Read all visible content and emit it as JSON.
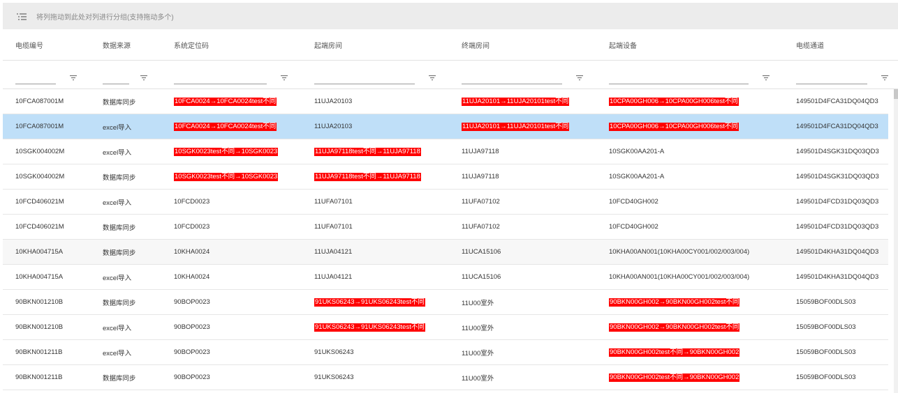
{
  "group_panel": {
    "placeholder": "将列拖动到此处对列进行分组(支持拖动多个)"
  },
  "columns": [
    "电缆编号",
    "数据来源",
    "系统定位码",
    "起端房间",
    "终端房间",
    "起端设备",
    "电缆通道"
  ],
  "rows": [
    {
      "cells": [
        "10FCA087001M",
        "数据库同步",
        "10FCA0024→10FCA0024test不同",
        "11UJA20103",
        "11UJA20101→11UJA20101test不同",
        "10CPA00GH006→10CPA00GH006test不同",
        "149501D4FCA31DQ04QD3"
      ],
      "highlight": [
        false,
        false,
        true,
        false,
        true,
        true,
        false
      ],
      "selected": false
    },
    {
      "cells": [
        "10FCA087001M",
        "excel导入",
        "10FCA0024→10FCA0024test不同",
        "11UJA20103",
        "11UJA20101→11UJA20101test不同",
        "10CPA00GH006→10CPA00GH006test不同",
        "149501D4FCA31DQ04QD3"
      ],
      "highlight": [
        false,
        false,
        true,
        false,
        true,
        true,
        false
      ],
      "selected": true
    },
    {
      "cells": [
        "10SGK004002M",
        "excel导入",
        "10SGK0023test不同→10SGK0023",
        "11UJA97118test不同→11UJA97118",
        "11UJA97118",
        "10SGK00AA201-A",
        "149501D4SGK31DQ03QD3"
      ],
      "highlight": [
        false,
        false,
        true,
        true,
        false,
        false,
        false
      ],
      "selected": false
    },
    {
      "cells": [
        "10SGK004002M",
        "数据库同步",
        "10SGK0023test不同→10SGK0023",
        "11UJA97118test不同→11UJA97118",
        "11UJA97118",
        "10SGK00AA201-A",
        "149501D4SGK31DQ03QD3"
      ],
      "highlight": [
        false,
        false,
        true,
        true,
        false,
        false,
        false
      ],
      "selected": false
    },
    {
      "cells": [
        "10FCD406021M",
        "excel导入",
        "10FCD0023",
        "11UFA07101",
        "11UFA07102",
        "10FCD40GH002",
        "149501D4FCD31DQ03QD3"
      ],
      "highlight": [
        false,
        false,
        false,
        false,
        false,
        false,
        false
      ],
      "selected": false
    },
    {
      "cells": [
        "10FCD406021M",
        "数据库同步",
        "10FCD0023",
        "11UFA07101",
        "11UFA07102",
        "10FCD40GH002",
        "149501D4FCD31DQ03QD3"
      ],
      "highlight": [
        false,
        false,
        false,
        false,
        false,
        false,
        false
      ],
      "selected": false
    },
    {
      "cells": [
        "10KHA004715A",
        "数据库同步",
        "10KHA0024",
        "11UJA04121",
        "11UCA15106",
        "10KHA00AN001(10KHA00CY001/002/003/004)",
        "149501D4KHA31DQ04QD3"
      ],
      "highlight": [
        false,
        false,
        false,
        false,
        false,
        false,
        false
      ],
      "selected": false
    },
    {
      "cells": [
        "10KHA004715A",
        "excel导入",
        "10KHA0024",
        "11UJA04121",
        "11UCA15106",
        "10KHA00AN001(10KHA00CY001/002/003/004)",
        "149501D4KHA31DQ04QD3"
      ],
      "highlight": [
        false,
        false,
        false,
        false,
        false,
        false,
        false
      ],
      "selected": false
    },
    {
      "cells": [
        "90BKN001210B",
        "数据库同步",
        "90BOP0023",
        "91UKS06243→91UKS06243test不同",
        "11U00室外",
        "90BKN00GH002→90BKN00GH002test不同",
        "15059BOF00DLS03"
      ],
      "highlight": [
        false,
        false,
        false,
        true,
        false,
        true,
        false
      ],
      "selected": false
    },
    {
      "cells": [
        "90BKN001210B",
        "excel导入",
        "90BOP0023",
        "91UKS06243→91UKS06243test不同",
        "11U00室外",
        "90BKN00GH002→90BKN00GH002test不同",
        "15059BOF00DLS03"
      ],
      "highlight": [
        false,
        false,
        false,
        true,
        false,
        true,
        false
      ],
      "selected": false
    },
    {
      "cells": [
        "90BKN001211B",
        "excel导入",
        "90BOP0023",
        "91UKS06243",
        "11U00室外",
        "90BKN00GH002test不同→90BKN00GH002",
        "15059BOF00DLS03"
      ],
      "highlight": [
        false,
        false,
        false,
        false,
        false,
        true,
        false
      ],
      "selected": false
    },
    {
      "cells": [
        "90BKN001211B",
        "数据库同步",
        "90BOP0023",
        "91UKS06243",
        "11U00室外",
        "90BKN00GH002test不同→90BKN00GH002",
        "15059BOF00DLS03"
      ],
      "highlight": [
        false,
        false,
        false,
        false,
        false,
        true,
        false
      ],
      "selected": false
    }
  ],
  "colors": {
    "highlight": "#ff0000",
    "selected_row": "#bfdff8",
    "group_bar": "#ececec"
  }
}
